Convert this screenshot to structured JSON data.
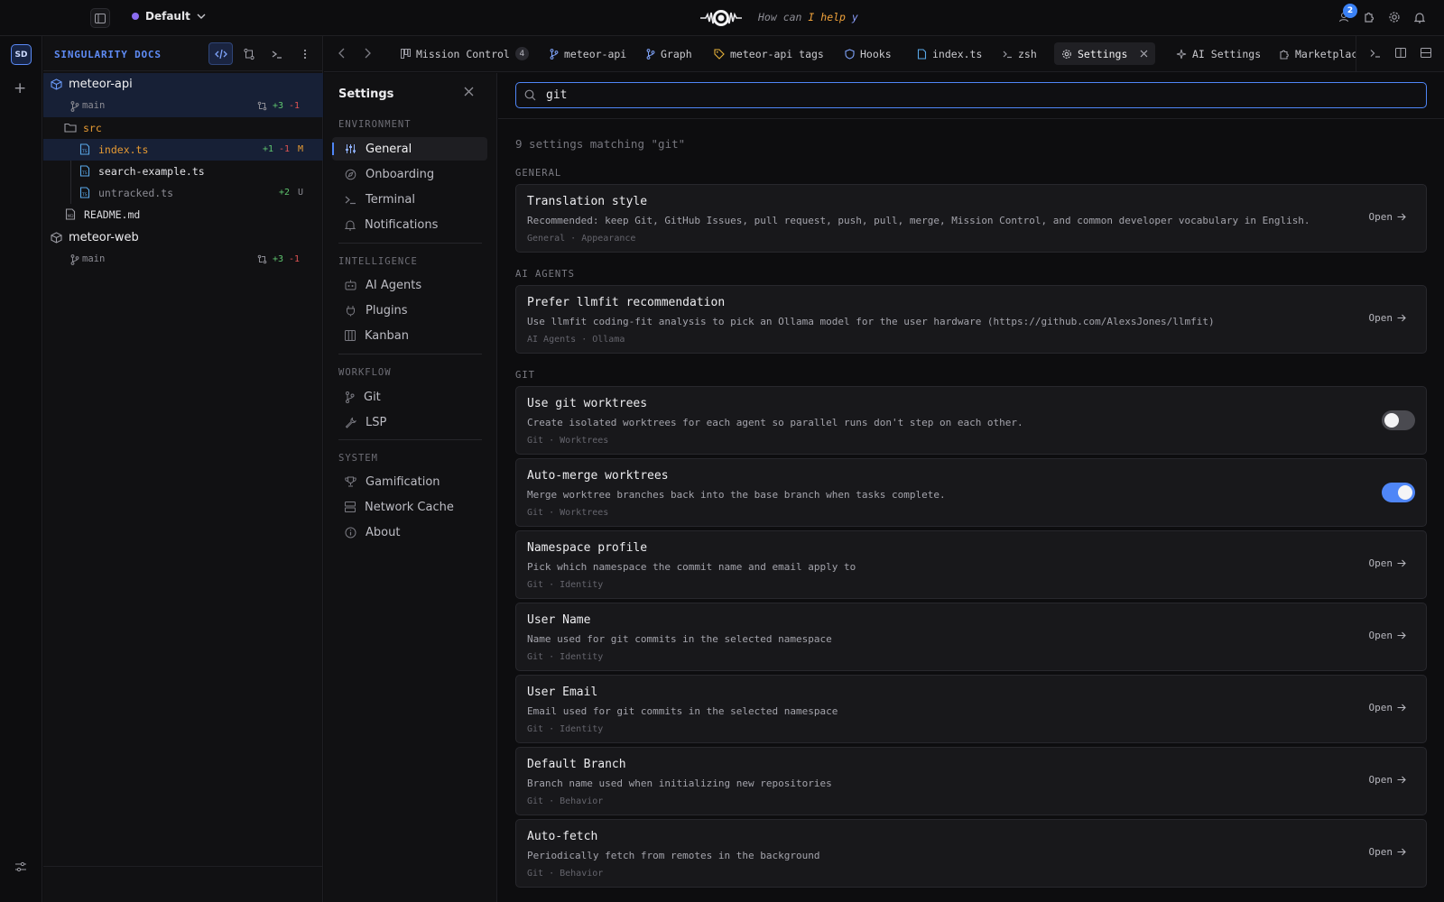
{
  "topbar": {
    "workspace": "Default",
    "prompt_parts": [
      "How can ",
      "I",
      " ",
      "help",
      " ",
      "y"
    ],
    "notification_count": "2"
  },
  "rail": {
    "avatar": "SD"
  },
  "tree": {
    "title": "SINGULARITY DOCS",
    "repos": [
      {
        "name": "meteor-api",
        "branch": "main",
        "added": "+3",
        "removed": "-1"
      },
      {
        "name": "meteor-web",
        "branch": "main",
        "added": "+3",
        "removed": "-1"
      }
    ],
    "folder": "src",
    "files": [
      {
        "name": "index.ts",
        "added": "+1",
        "removed": "-1",
        "status": "M"
      },
      {
        "name": "search-example.ts"
      },
      {
        "name": "untracked.ts",
        "added": "+2",
        "status": "U"
      },
      {
        "name": "README.md"
      }
    ]
  },
  "tabs": [
    {
      "label": "Mission Control",
      "count": "4",
      "icon": "kanban-icon"
    },
    {
      "label": "meteor-api",
      "icon": "branch-icon"
    },
    {
      "label": "Graph",
      "icon": "branch-icon"
    },
    {
      "label": "meteor-api tags",
      "icon": "tag-icon"
    },
    {
      "label": "Hooks",
      "icon": "shield-icon"
    },
    {
      "label": "index.ts",
      "icon": "file-icon"
    },
    {
      "label": "zsh",
      "icon": "terminal-icon"
    },
    {
      "label": "Settings",
      "icon": "gear-icon",
      "active": true
    },
    {
      "label": "AI Settings",
      "icon": "sparkle-icon"
    },
    {
      "label": "Marketplac",
      "icon": "puzzle-icon"
    }
  ],
  "settings_nav": {
    "title": "Settings",
    "sections": [
      {
        "label": "ENVIRONMENT",
        "items": [
          "General",
          "Onboarding",
          "Terminal",
          "Notifications"
        ]
      },
      {
        "label": "INTELLIGENCE",
        "items": [
          "AI Agents",
          "Plugins",
          "Kanban"
        ]
      },
      {
        "label": "WORKFLOW",
        "items": [
          "Git",
          "LSP"
        ]
      },
      {
        "label": "SYSTEM",
        "items": [
          "Gamification",
          "Network Cache",
          "About"
        ]
      }
    ],
    "active": "General"
  },
  "search": {
    "value": "git"
  },
  "results": {
    "count_label": "9 settings matching \"git\"",
    "open_label": "Open",
    "groups": [
      {
        "label": "GENERAL"
      },
      {
        "label": "AI AGENTS"
      },
      {
        "label": "GIT"
      }
    ],
    "items": [
      {
        "title": "Translation style",
        "desc": "Recommended: keep Git, GitHub Issues, pull request, push, pull, merge, Mission Control, and common developer vocabulary in English.",
        "meta": "General · Appearance",
        "control": "open"
      },
      {
        "title": "Prefer llmfit recommendation",
        "desc": "Use llmfit coding-fit analysis to pick an Ollama model for the user hardware (https://github.com/AlexsJones/llmfit)",
        "meta": "AI Agents · Ollama",
        "control": "open"
      },
      {
        "title": "Use git worktrees",
        "desc": "Create isolated worktrees for each agent so parallel runs don't step on each other.",
        "meta": "Git · Worktrees",
        "control": "toggle",
        "enabled": false
      },
      {
        "title": "Auto-merge worktrees",
        "desc": "Merge worktree branches back into the base branch when tasks complete.",
        "meta": "Git · Worktrees",
        "control": "toggle",
        "enabled": true
      },
      {
        "title": "Namespace profile",
        "desc": "Pick which namespace the commit name and email apply to",
        "meta": "Git · Identity",
        "control": "open"
      },
      {
        "title": "User Name",
        "desc": "Name used for git commits in the selected namespace",
        "meta": "Git · Identity",
        "control": "open"
      },
      {
        "title": "User Email",
        "desc": "Email used for git commits in the selected namespace",
        "meta": "Git · Identity",
        "control": "open"
      },
      {
        "title": "Default Branch",
        "desc": "Branch name used when initializing new repositories",
        "meta": "Git · Behavior",
        "control": "open"
      },
      {
        "title": "Auto-fetch",
        "desc": "Periodically fetch from remotes in the background",
        "meta": "Git · Behavior",
        "control": "open"
      }
    ]
  },
  "colors": {
    "accent": "#4f86f7",
    "added": "#5ec46e",
    "removed": "#e05454",
    "modified": "#e69a33"
  }
}
